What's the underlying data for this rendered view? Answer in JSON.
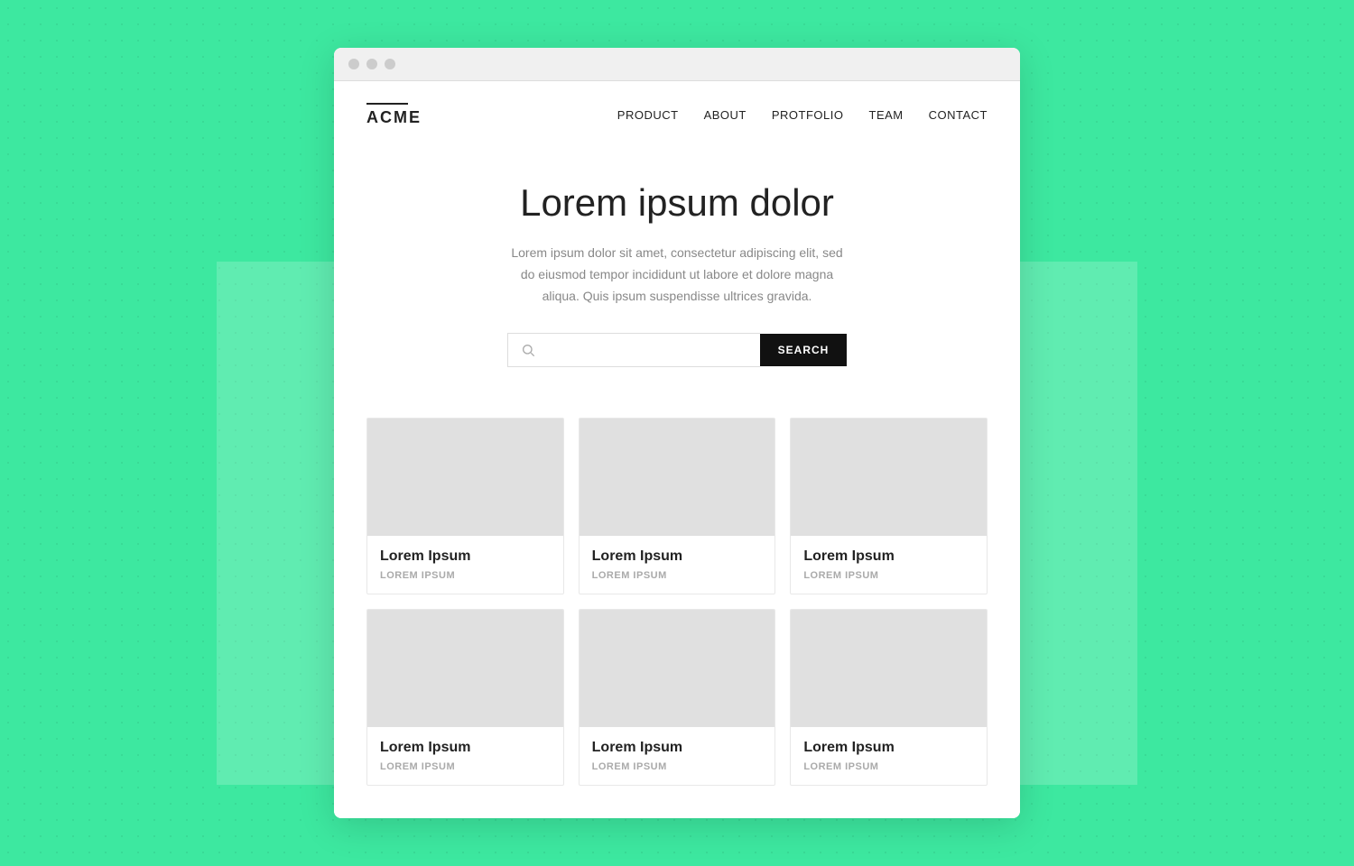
{
  "background": {
    "color": "#3de8a0"
  },
  "browser": {
    "dots": [
      "dot1",
      "dot2",
      "dot3"
    ]
  },
  "navbar": {
    "logo": "ACME",
    "links": [
      {
        "label": "PRODUCT",
        "id": "product"
      },
      {
        "label": "ABOUT",
        "id": "about"
      },
      {
        "label": "PROTFOLIO",
        "id": "protfolio"
      },
      {
        "label": "TEAM",
        "id": "team"
      },
      {
        "label": "CONTACT",
        "id": "contact"
      }
    ]
  },
  "hero": {
    "title": "Lorem ipsum dolor",
    "description": "Lorem ipsum dolor sit amet, consectetur adipiscing elit, sed do eiusmod tempor incididunt ut labore et dolore magna aliqua. Quis ipsum suspendisse ultrices gravida."
  },
  "search": {
    "placeholder": "",
    "button_label": "SEARCH"
  },
  "cards": [
    {
      "title": "Lorem Ipsum",
      "subtitle": "LOREM IPSUM"
    },
    {
      "title": "Lorem Ipsum",
      "subtitle": "LOREM IPSUM"
    },
    {
      "title": "Lorem Ipsum",
      "subtitle": "LOREM IPSUM"
    },
    {
      "title": "Lorem Ipsum",
      "subtitle": "LOREM IPSUM"
    },
    {
      "title": "Lorem Ipsum",
      "subtitle": "LOREM IPSUM"
    },
    {
      "title": "Lorem Ipsum",
      "subtitle": "LOREM IPSUM"
    }
  ]
}
